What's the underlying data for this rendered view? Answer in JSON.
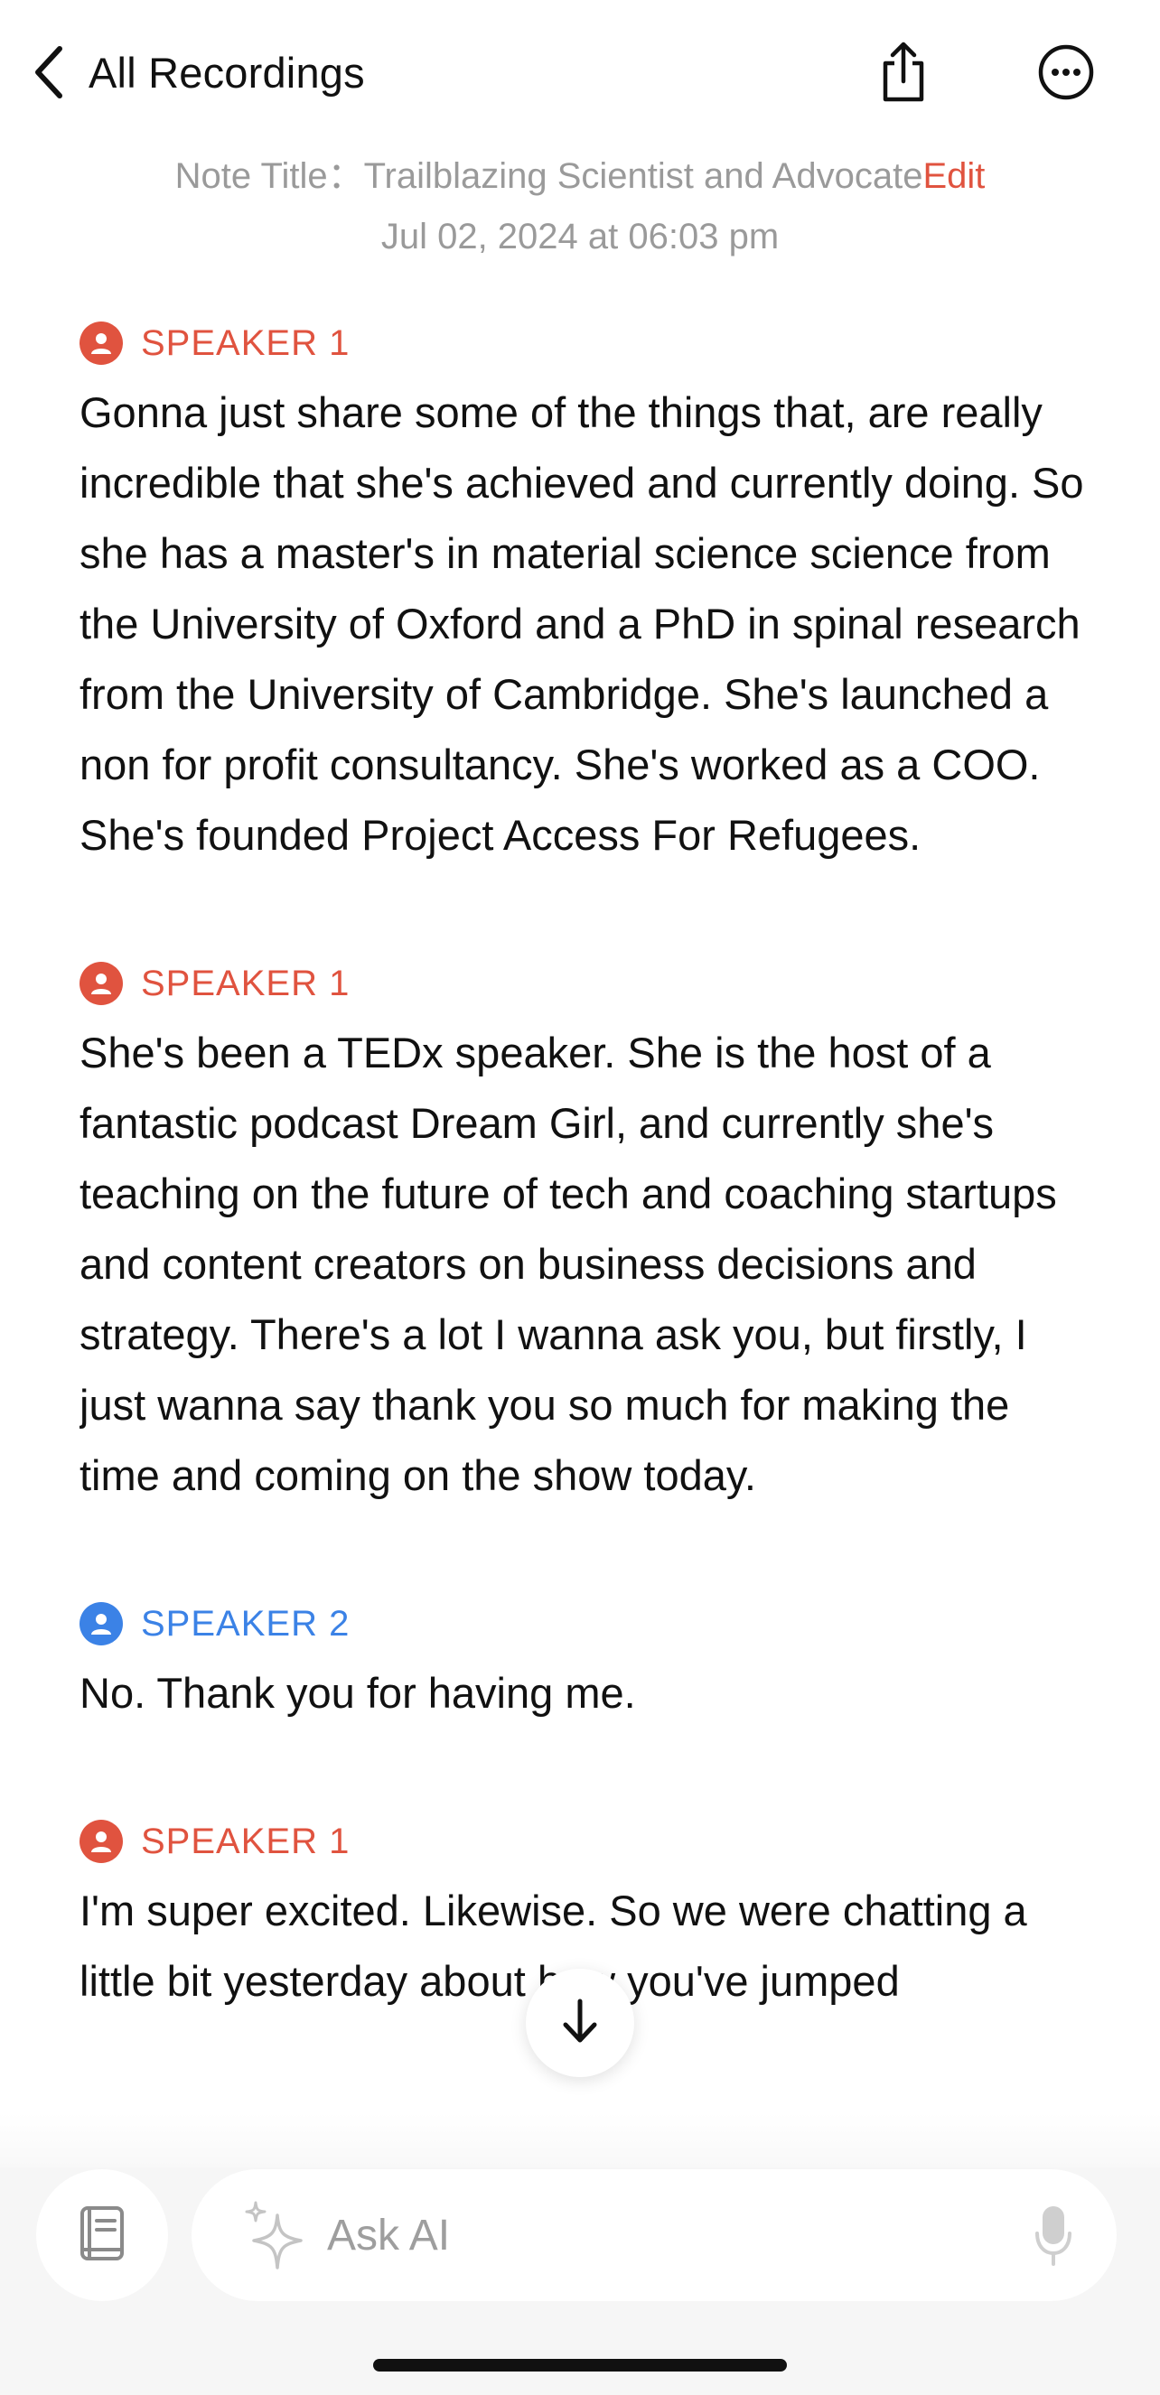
{
  "header": {
    "back_label": "All Recordings",
    "back_icon": "chevron-left-icon",
    "share_icon": "share-icon",
    "more_icon": "more-icon"
  },
  "note": {
    "title_prefix": "Note Title：",
    "title": "Trailblazing Scientist and Advocate",
    "edit_label": "Edit",
    "date": "Jul 02, 2024 at 06:03 pm"
  },
  "transcript": [
    {
      "speaker": "SPEAKER 1",
      "text": "Gonna just share some of the things that, are really incredible that she's achieved and currently doing. So she has a master's in material science science from the University of Oxford and a PhD in spinal research from the University of Cambridge. She's launched a non for profit consultancy. She's worked as a COO. She's founded Project Access For Refugees."
    },
    {
      "speaker": "SPEAKER 1",
      "text": "She's been a TEDx speaker. She is the host of a fantastic podcast Dream Girl, and currently she's teaching on the future of tech and coaching startups and content creators on business decisions and strategy. There's a lot I wanna ask you, but firstly, I just wanna say thank you so much for making the time and coming on the show today."
    },
    {
      "speaker": "SPEAKER 2",
      "text": "No. Thank you for having me."
    },
    {
      "speaker": "SPEAKER 1",
      "text": "I'm super excited. Likewise. So we were chatting a little bit yesterday about how you've jumped"
    }
  ],
  "bottom": {
    "ask_placeholder": "Ask AI",
    "book_icon": "book-icon",
    "sparkle_icon": "sparkle-icon",
    "mic_icon": "microphone-icon",
    "scroll_icon": "arrow-down-icon"
  },
  "colors": {
    "speaker1": "#e0533f",
    "speaker2": "#3b82e6",
    "accent": "#e0533f",
    "muted": "#9a9a9a"
  }
}
